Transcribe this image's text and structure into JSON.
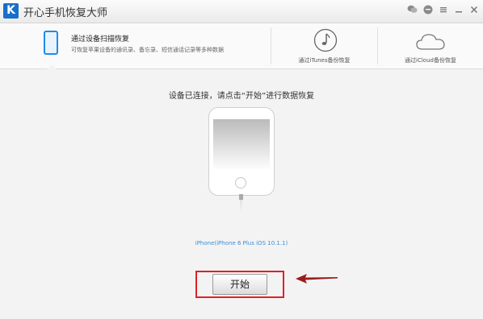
{
  "app": {
    "logo_text": "K",
    "title": "开心手机恢复大师"
  },
  "window_controls": [
    "wechat-icon",
    "chat-icon",
    "settings-icon",
    "minimize-icon",
    "close-icon"
  ],
  "tabs": [
    {
      "title": "通过设备扫描恢复",
      "description": "可恢复苹果设备的通讯录、备忘录、短信通话记录等多种数据",
      "icon": "phone-icon",
      "active": true
    },
    {
      "label": "通过iTunes备份恢复",
      "icon": "music-note-icon",
      "active": false
    },
    {
      "label": "通过iCloud备份恢复",
      "icon": "cloud-icon",
      "active": false
    }
  ],
  "main": {
    "instruction": "设备已连接，请点击“开始”进行数据恢复",
    "device_info": "iPhone(iPhone 6 Plus iOS 10.1.1)",
    "start_label": "开始"
  },
  "colors": {
    "accent": "#1f8be8",
    "link": "#3b8fd9",
    "highlight": "#e11f26",
    "arrow": "#9a1c1c"
  }
}
